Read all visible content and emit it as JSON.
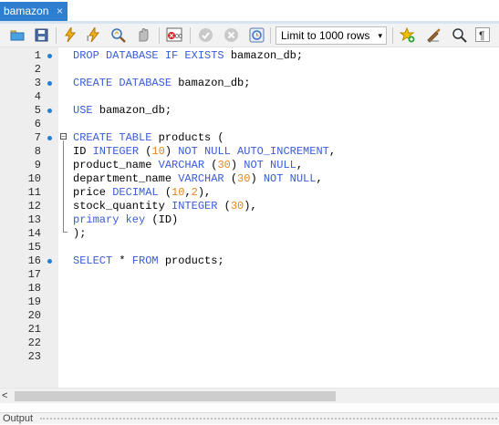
{
  "tab": {
    "title": "bamazon",
    "close_glyph": "×"
  },
  "toolbar": {
    "limit_select": {
      "selected": "Limit to 1000 rows",
      "arrow": "▾"
    },
    "icons": [
      "open-file-icon",
      "save-icon",
      "execute-icon",
      "execute-current-icon",
      "explain-icon",
      "stop-icon",
      "toggle-error-icon",
      "commit-icon",
      "rollback-icon",
      "autocommit-icon",
      "add-snippet-icon",
      "beautify-icon",
      "find-icon",
      "invisible-chars-icon"
    ]
  },
  "editor": {
    "line_numbers": [
      "1",
      "2",
      "3",
      "4",
      "5",
      "6",
      "7",
      "8",
      "9",
      "10",
      "11",
      "12",
      "13",
      "14",
      "15",
      "16",
      "17",
      "18",
      "19",
      "20",
      "21",
      "22",
      "23"
    ],
    "statement_markers": [
      1,
      3,
      5,
      7,
      16
    ],
    "lines": [
      [
        [
          "kw",
          "DROP DATABASE IF EXISTS "
        ],
        [
          "t",
          "bamazon_db;"
        ]
      ],
      [],
      [
        [
          "kw",
          "CREATE DATABASE "
        ],
        [
          "t",
          "bamazon_db;"
        ]
      ],
      [],
      [
        [
          "kw",
          "USE "
        ],
        [
          "t",
          "bamazon_db;"
        ]
      ],
      [],
      [
        [
          "kw",
          "CREATE TABLE "
        ],
        [
          "t",
          "products ("
        ]
      ],
      [
        [
          "t",
          "ID "
        ],
        [
          "kw",
          "INTEGER "
        ],
        [
          "t",
          "("
        ],
        [
          "num",
          "10"
        ],
        [
          "t",
          ") "
        ],
        [
          "kw",
          "NOT NULL AUTO_INCREMENT"
        ],
        [
          "t",
          ","
        ]
      ],
      [
        [
          "t",
          "product_name "
        ],
        [
          "kw",
          "VARCHAR "
        ],
        [
          "t",
          "("
        ],
        [
          "num",
          "30"
        ],
        [
          "t",
          ") "
        ],
        [
          "kw",
          "NOT NULL"
        ],
        [
          "t",
          ","
        ]
      ],
      [
        [
          "t",
          "department_name "
        ],
        [
          "kw",
          "VARCHAR "
        ],
        [
          "t",
          "("
        ],
        [
          "num",
          "30"
        ],
        [
          "t",
          ") "
        ],
        [
          "kw",
          "NOT NULL"
        ],
        [
          "t",
          ","
        ]
      ],
      [
        [
          "t",
          "price "
        ],
        [
          "kw",
          "DECIMAL "
        ],
        [
          "t",
          "("
        ],
        [
          "num",
          "10"
        ],
        [
          "t",
          ","
        ],
        [
          "num",
          "2"
        ],
        [
          "t",
          "),"
        ]
      ],
      [
        [
          "t",
          "stock_quantity "
        ],
        [
          "kw",
          "INTEGER "
        ],
        [
          "t",
          "("
        ],
        [
          "num",
          "30"
        ],
        [
          "t",
          "),"
        ]
      ],
      [
        [
          "kw",
          "primary key "
        ],
        [
          "t",
          "(ID)"
        ]
      ],
      [
        [
          "t",
          ");"
        ]
      ],
      [],
      [
        [
          "kw",
          "SELECT "
        ],
        [
          "t",
          "* "
        ],
        [
          "kw",
          "FROM "
        ],
        [
          "t",
          "products;"
        ]
      ]
    ]
  },
  "fold_marker": "−",
  "scroll": {
    "left_arrow": "<"
  },
  "output": {
    "label": "Output"
  },
  "colors": {
    "tab": "#2f7fd0",
    "keyword": "#3a5cd8",
    "number": "#e0861c",
    "marker": "#1f7ed8"
  }
}
